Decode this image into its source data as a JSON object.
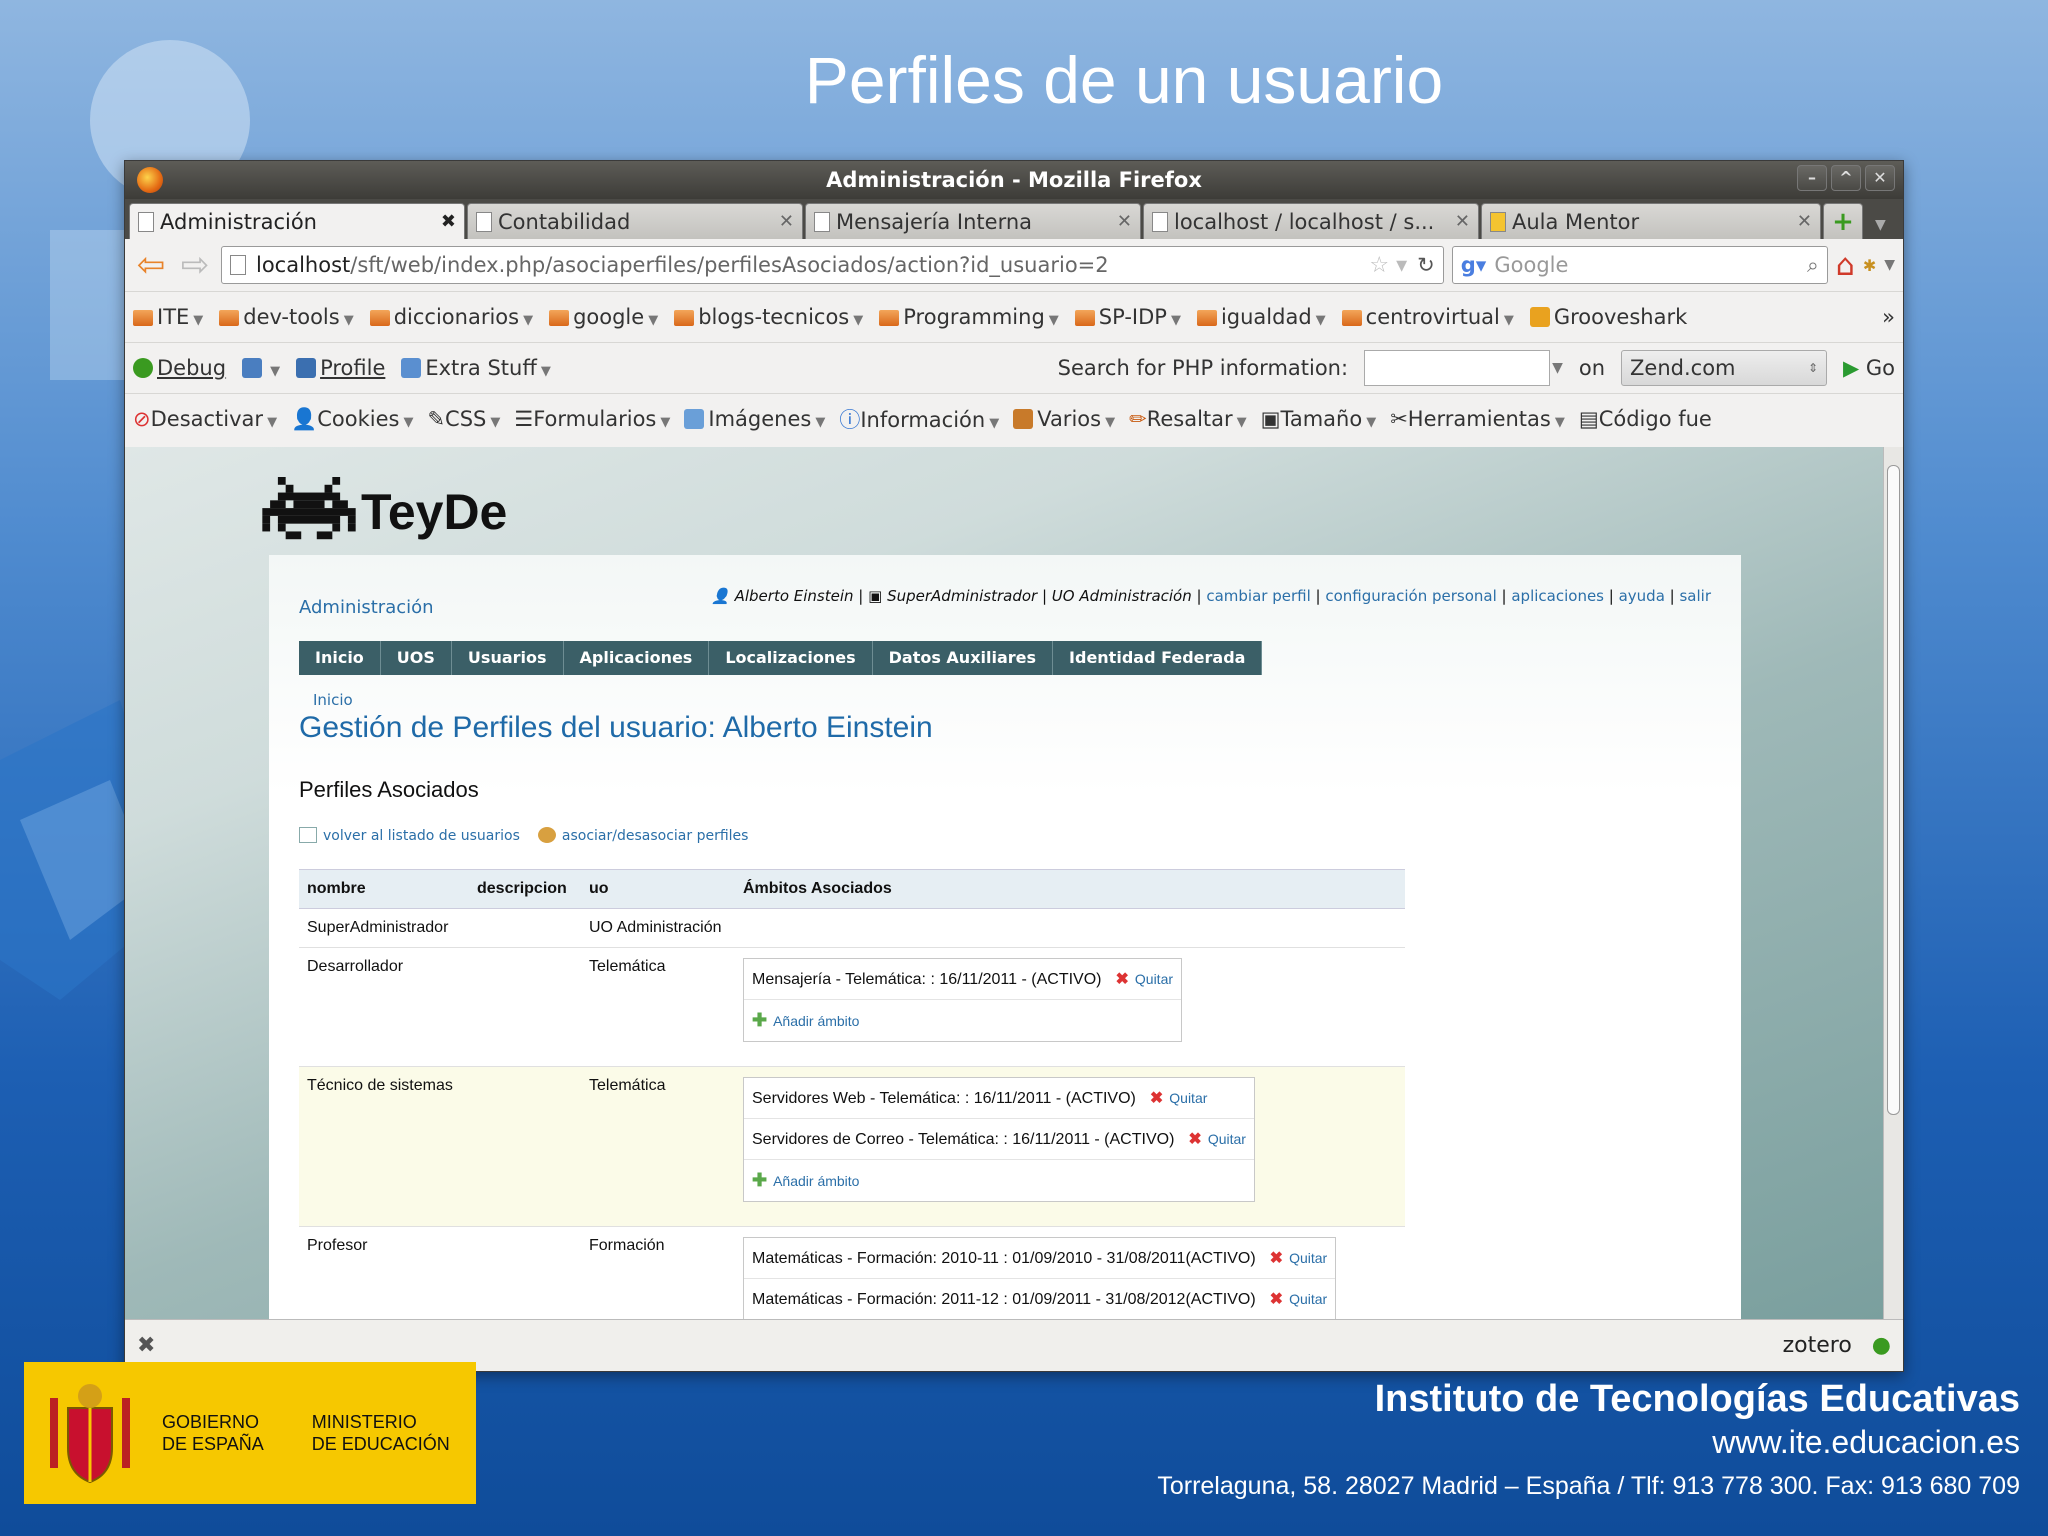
{
  "slide": {
    "title": "Perfiles de un usuario",
    "institute": "Instituto de Tecnologías Educativas",
    "website": "www.ite.educacion.es",
    "address": "Torrelaguna, 58. 28027 Madrid – España / Tlf: 913 778 300. Fax: 913 680 709",
    "gov_line1": "GOBIERNO",
    "gov_line2": "DE ESPAÑA",
    "min_line1": "MINISTERIO",
    "min_line2": "DE EDUCACIÓN"
  },
  "browser": {
    "window_title": "Administración - Mozilla Firefox",
    "tabs": [
      {
        "label": "Administración",
        "active": true
      },
      {
        "label": "Contabilidad"
      },
      {
        "label": "Mensajería Interna"
      },
      {
        "label": "localhost / localhost / s..."
      },
      {
        "label": "Aula Mentor"
      }
    ],
    "url_host": "localhost",
    "url_path": "/sft/web/index.php/asociaperfiles/perfilesAsociados/action?id_usuario=2",
    "search_placeholder": "Google",
    "bookmarks": [
      "ITE",
      "dev-tools",
      "diccionarios",
      "google",
      "blogs-tecnicos",
      "Programming",
      "SP-IDP",
      "igualdad",
      "centrovirtual",
      "Grooveshark"
    ],
    "toolbar2": {
      "debug": "Debug",
      "profile": "Profile",
      "extra": "Extra Stuff",
      "php_label": "Search for PHP information:",
      "on": "on",
      "site": "Zend.com",
      "go": "Go"
    },
    "devtools": [
      "Desactivar",
      "Cookies",
      "CSS",
      "Formularios",
      "Imágenes",
      "Información",
      "Varios",
      "Resaltar",
      "Tamaño",
      "Herramientas",
      "Código fue"
    ],
    "status_zotero": "zotero"
  },
  "app": {
    "logo": "TeyDe",
    "section": "Administración",
    "user": "Alberto Einstein",
    "role": "SuperAdministrador",
    "uo": "UO Administración",
    "links": [
      "cambiar perfil",
      "configuración personal",
      "aplicaciones",
      "ayuda",
      "salir"
    ],
    "menu": [
      "Inicio",
      "UOS",
      "Usuarios",
      "Aplicaciones",
      "Localizaciones",
      "Datos Auxiliares",
      "Identidad Federada"
    ],
    "breadcrumb": "Inicio",
    "heading": "Gestión de Perfiles del usuario: Alberto Einstein",
    "subheading": "Perfiles Asociados",
    "action_back": "volver al listado de usuarios",
    "action_assoc": "asociar/desasociar perfiles",
    "columns": [
      "nombre",
      "descripcion",
      "uo",
      "Ámbitos Asociados"
    ],
    "rows": [
      {
        "nombre": "SuperAdministrador",
        "descripcion": "",
        "uo": "UO Administración",
        "ambitos": []
      },
      {
        "nombre": "Desarrollador",
        "descripcion": "",
        "uo": "Telemática",
        "ambitos": [
          "Mensajería - Telemática: : 16/11/2011 - (ACTIVO)"
        ],
        "add": "Añadir ámbito"
      },
      {
        "nombre": "Técnico de sistemas",
        "descripcion": "",
        "uo": "Telemática",
        "ambitos": [
          "Servidores Web - Telemática: : 16/11/2011 - (ACTIVO)",
          "Servidores de Correo - Telemática: : 16/11/2011 - (ACTIVO)"
        ],
        "add": "Añadir ámbito"
      },
      {
        "nombre": "Profesor",
        "descripcion": "",
        "uo": "Formación",
        "ambitos": [
          "Matemáticas - Formación: 2010-11 : 01/09/2010 - 31/08/2011(ACTIVO)",
          "Matemáticas - Formación: 2011-12 : 01/09/2011 - 31/08/2012(ACTIVO)"
        ]
      }
    ],
    "quitar": "Quitar"
  }
}
